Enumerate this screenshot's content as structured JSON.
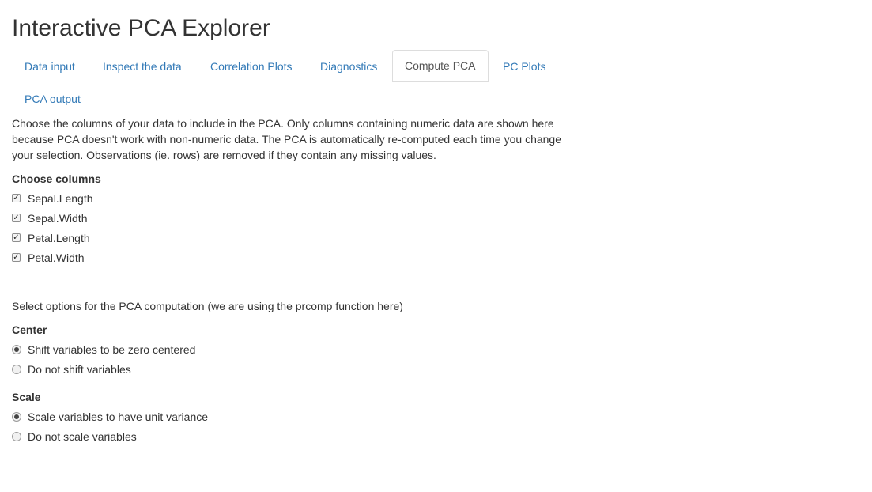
{
  "app": {
    "title": "Interactive PCA Explorer"
  },
  "tabs": [
    {
      "label": "Data input",
      "active": false
    },
    {
      "label": "Inspect the data",
      "active": false
    },
    {
      "label": "Correlation Plots",
      "active": false
    },
    {
      "label": "Diagnostics",
      "active": false
    },
    {
      "label": "Compute PCA",
      "active": true
    },
    {
      "label": "PC Plots",
      "active": false
    },
    {
      "label": "PCA output",
      "active": false
    }
  ],
  "compute_pca": {
    "description": "Choose the columns of your data to include in the PCA. Only columns containing numeric data are shown here because PCA doesn't work with non-numeric data. The PCA is automatically re-computed each time you change your selection. Observations (ie. rows) are removed if they contain any missing values.",
    "columns_label": "Choose columns",
    "columns": [
      {
        "label": "Sepal.Length",
        "checked": true
      },
      {
        "label": "Sepal.Width",
        "checked": true
      },
      {
        "label": "Petal.Length",
        "checked": true
      },
      {
        "label": "Petal.Width",
        "checked": true
      }
    ],
    "options_note": "Select options for the PCA computation (we are using the prcomp function here)",
    "center": {
      "label": "Center",
      "options": [
        {
          "label": "Shift variables to be zero centered",
          "selected": true
        },
        {
          "label": "Do not shift variables",
          "selected": false
        }
      ]
    },
    "scale": {
      "label": "Scale",
      "options": [
        {
          "label": "Scale variables to have unit variance",
          "selected": true
        },
        {
          "label": "Do not scale variables",
          "selected": false
        }
      ]
    }
  },
  "icons": {
    "checkbox_checked": "checkbox-checked-icon",
    "radio_selected": "radio-selected-icon",
    "radio_unselected": "radio-unselected-icon"
  },
  "colors": {
    "link": "#337ab7",
    "active_tab_text": "#555555",
    "border": "#dddddd",
    "text": "#333333"
  }
}
